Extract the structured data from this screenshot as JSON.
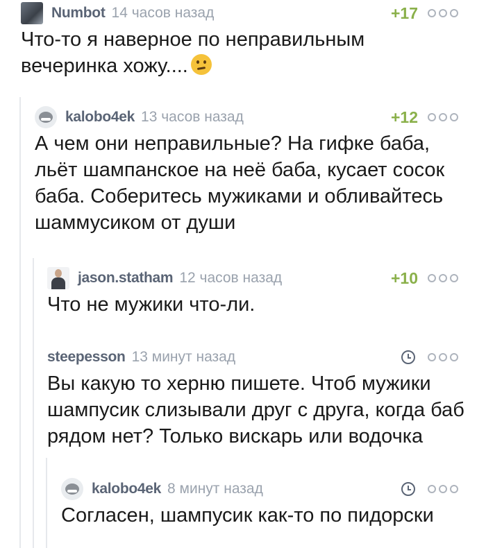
{
  "comments": [
    {
      "author": "Numbot",
      "time": "14 часов назад",
      "rating": "+17",
      "text": "Что-то я наверное по неправильным вечеринка хожу....",
      "emoji_icon": "thinking-face-icon"
    },
    {
      "author": "kalobo4ek",
      "time": "13 часов назад",
      "rating": "+12",
      "text": "А чем они неправильные? На гифке баба, льёт шампанское на неё баба, кусает сосок баба. Соберитесь мужиками и обливайтесь шаммусиком от души"
    },
    {
      "author": "jason.statham",
      "time": "12 часов назад",
      "rating": "+10",
      "text": "Что не мужики что-ли."
    },
    {
      "author": "steepesson",
      "time": "13 минут назад",
      "text": "Вы какую то херню пишете. Чтоб мужики шампусик слизывали друг с друга, когда баб рядом нет? Только вискарь или водочка"
    },
    {
      "author": "kalobo4ek",
      "time": "8 минут назад",
      "text": "Согласен, шампусик как-то по пидорски"
    }
  ],
  "colors": {
    "author": "#5a6475",
    "time": "#9aa2ad",
    "rating": "#8ab04a",
    "thread_line": "#e6e8ec"
  }
}
